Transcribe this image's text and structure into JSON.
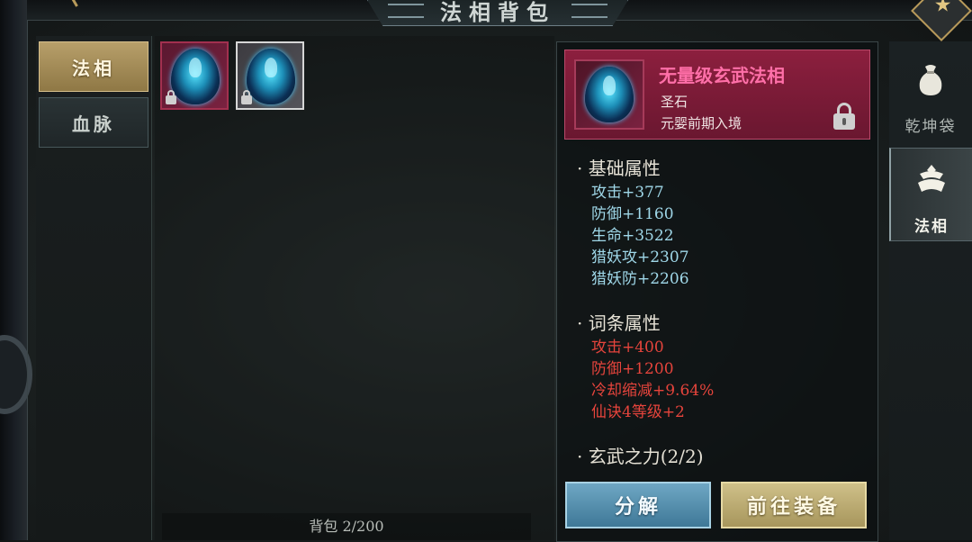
{
  "header": {
    "title": "法相背包"
  },
  "tabs": [
    {
      "label": "法相",
      "active": true
    },
    {
      "label": "血脉",
      "active": false
    }
  ],
  "grid": {
    "items": [
      {
        "icon": "blue-flame-egg-icon",
        "rarity_color": "#a2304f",
        "locked": true
      },
      {
        "icon": "blue-flame-egg-icon",
        "rarity_color": "#d6d6d6",
        "locked": true
      }
    ],
    "bag_count": "背包 2/200"
  },
  "detail": {
    "name": "无量级玄武法相",
    "type": "圣石",
    "realm": "元婴前期入境",
    "base_title": "· 基础属性",
    "base_stats": [
      "攻击+377",
      "防御+1160",
      "生命+3522",
      "猎妖攻+2307",
      "猎妖防+2206"
    ],
    "affix_title": "· 词条属性",
    "affix_stats": [
      "攻击+400",
      "防御+1200",
      "冷却缩减+9.64%",
      "仙诀4等级+2"
    ],
    "power_title": "· 玄武之力(2/2)"
  },
  "buttons": {
    "dismantle": "分解",
    "equip": "前往装备"
  },
  "right_nav": [
    {
      "label": "乾坤袋",
      "icon": "money-bag-icon",
      "active": false
    },
    {
      "label": "法相",
      "icon": "faxiang-icon",
      "active": true
    }
  ],
  "colors": {
    "accent_gold": "#b79f6a",
    "rarity_red": "#8c1f3e",
    "base_stat": "#9fd7e8",
    "affix_stat": "#e6443c",
    "item_name": "#ff6fa8"
  }
}
